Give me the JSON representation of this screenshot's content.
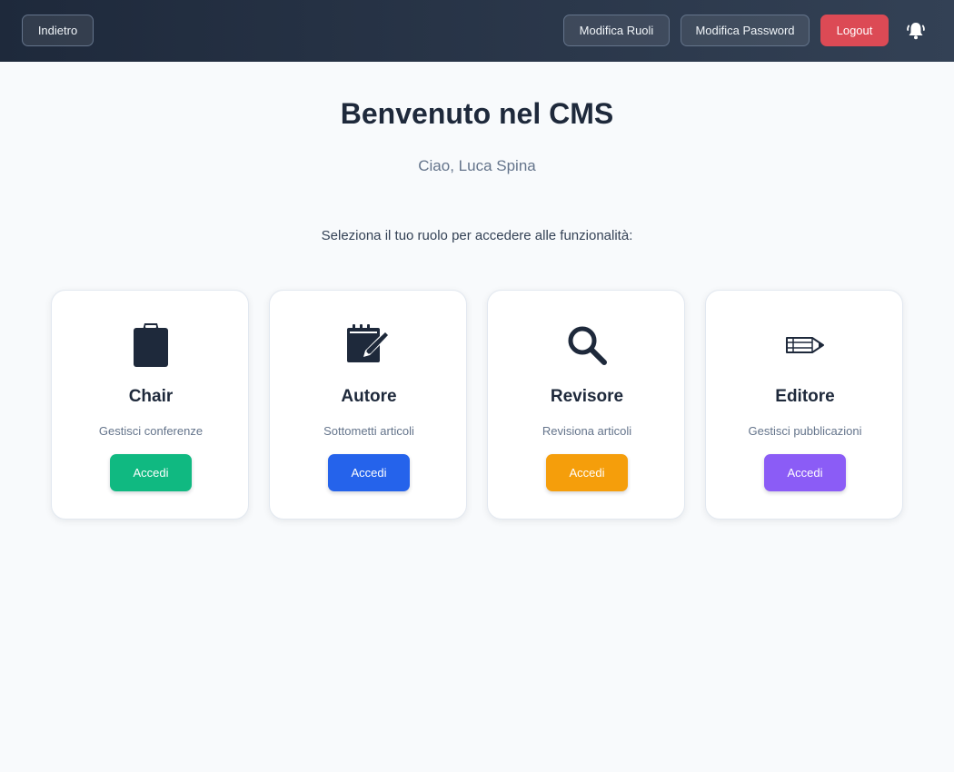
{
  "header": {
    "back_label": "Indietro",
    "edit_roles_label": "Modifica Ruoli",
    "edit_password_label": "Modifica Password",
    "logout_label": "Logout",
    "notification_icon": "bell-icon",
    "logout_color": "#dc4a55"
  },
  "main": {
    "title": "Benvenuto nel CMS",
    "greeting": "Ciao, Luca Spina",
    "instruction": "Seleziona il tuo ruolo per accedere alle funzionalità:"
  },
  "roles": [
    {
      "title": "Chair",
      "description": "Gestisci conferenze",
      "button_label": "Accedi",
      "icon": "clipboard-icon",
      "color": "#10b981"
    },
    {
      "title": "Autore",
      "description": "Sottometti articoli",
      "button_label": "Accedi",
      "icon": "notepad-pencil-icon",
      "color": "#2563eb"
    },
    {
      "title": "Revisore",
      "description": "Revisiona articoli",
      "button_label": "Accedi",
      "icon": "magnifier-icon",
      "color": "#f59e0b"
    },
    {
      "title": "Editore",
      "description": "Gestisci pubblicazioni",
      "button_label": "Accedi",
      "icon": "pencil-icon",
      "color": "#8b5cf6"
    }
  ]
}
